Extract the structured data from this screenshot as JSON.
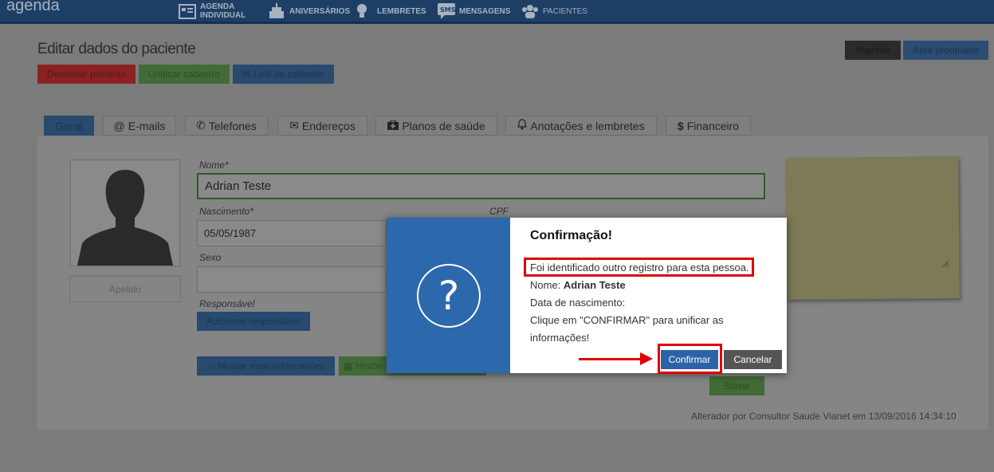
{
  "nav": {
    "brand": "agenda",
    "items": [
      {
        "line1": "AGENDA",
        "line2": "INDIVIDUAL",
        "icon": "calendar-icon"
      },
      {
        "label": "ANIVERSÁRIOS",
        "icon": "cake-icon"
      },
      {
        "label": "LEMBRETES",
        "icon": "lightbulb-icon"
      },
      {
        "label": "MENSAGENS",
        "icon": "sms-icon"
      },
      {
        "label": "PACIENTES",
        "icon": "users-icon"
      }
    ]
  },
  "page": {
    "title": "Editar dados do paciente",
    "actions": {
      "deactivate": "Desativar paciente",
      "merge": "Unificar cadastro",
      "link": "Link de cadastro",
      "print": "Imprimir",
      "open_record": "Abrir prontuário"
    },
    "tabs": [
      {
        "label": "Geral"
      },
      {
        "label": "E-mails",
        "icon": "@"
      },
      {
        "label": "Telefones",
        "icon": "phone-icon"
      },
      {
        "label": "Endereços",
        "icon": "envelope-icon"
      },
      {
        "label": "Planos de saúde",
        "icon": "medkit-icon"
      },
      {
        "label": "Anotações e lembretes",
        "icon": "bell-icon"
      },
      {
        "label": "Financeiro",
        "icon": "$"
      }
    ]
  },
  "form": {
    "nome_label": "Nome*",
    "nome_value": "Adrian Teste",
    "nascimento_label": "Nascimento*",
    "nascimento_value": "05/05/1987",
    "cpf_label": "CPF",
    "sexo_label": "Sexo",
    "responsavel_label": "Responsável",
    "add_responsavel": "Adicionar responsável",
    "apelido_placeholder": "Apelido",
    "more_info": "Mostar mais informações",
    "history": "Históri",
    "save": "Salvar",
    "footer": "Alterador por Consultor Saude Vianet em 13/09/2016 14:34:10"
  },
  "dialog": {
    "title": "Confirmação!",
    "message": "Foi identificado outro registro para esta pessoa.",
    "name_label": "Nome:",
    "name_value": "Adrian Teste",
    "birth_label": "Data de nascimento:",
    "instruction_line1": "Clique em \"CONFIRMAR\" para unificar as",
    "instruction_line2": "informações!",
    "confirm": "Confirmar",
    "cancel": "Cancelar"
  },
  "colors": {
    "modal_side": "#2c69ac",
    "highlight": "#e00000",
    "confirm": "#2a64a6"
  }
}
